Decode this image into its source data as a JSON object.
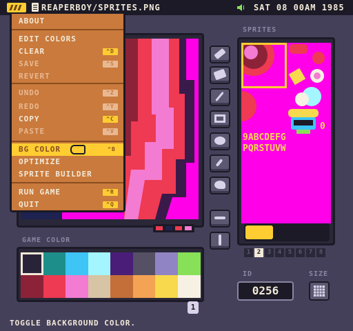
{
  "topbar": {
    "file_path": "REAPERBOY/SPRITES.PNG",
    "clock": "SAT 08 00AM 1985",
    "logo_icon": "app-logo-icon",
    "speaker_icon": "speaker-icon"
  },
  "menu": {
    "items": [
      {
        "label": "ABOUT",
        "shortcut": "",
        "enabled": true
      },
      {
        "label": "EDIT COLORS",
        "shortcut": "",
        "enabled": true
      },
      {
        "label": "CLEAR",
        "shortcut": "^D",
        "enabled": true
      },
      {
        "label": "SAVE",
        "shortcut": "^S",
        "enabled": false
      },
      {
        "label": "REVERT",
        "shortcut": "",
        "enabled": false
      },
      {
        "label": "UNDO",
        "shortcut": "^Z",
        "enabled": false
      },
      {
        "label": "REDO",
        "shortcut": "^Y",
        "enabled": false
      },
      {
        "label": "COPY",
        "shortcut": "^C",
        "enabled": true
      },
      {
        "label": "PASTE",
        "shortcut": "^V",
        "enabled": false
      },
      {
        "label": "BG COLOR",
        "shortcut": "^B",
        "enabled": true,
        "highlighted": true
      },
      {
        "label": "OPTIMIZE",
        "shortcut": "",
        "enabled": true
      },
      {
        "label": "SPRITE BUILDER",
        "shortcut": "",
        "enabled": true
      },
      {
        "label": "RUN GAME",
        "shortcut": "^R",
        "enabled": true
      },
      {
        "label": "QUIT",
        "shortcut": "^Q",
        "enabled": true
      }
    ]
  },
  "tools": [
    "pen-tool-icon",
    "eraser-tool-icon",
    "line-tool-icon",
    "rect-tool-icon",
    "ellipse-tool-icon",
    "eyedropper-tool-icon",
    "fill-tool-icon"
  ],
  "tools_transform": [
    "flip-horizontal-icon",
    "flip-vertical-icon"
  ],
  "sprites": {
    "label": "SPRITES",
    "font_row_1": "9ABCDEFG",
    "font_row_2": "PQRSTUVW",
    "font_extra": "0",
    "banks": [
      "1",
      "2",
      "3",
      "4",
      "5",
      "6",
      "7",
      "8"
    ],
    "active_bank": "2"
  },
  "id": {
    "label": "ID",
    "value": "0256"
  },
  "size": {
    "label": "SIZE"
  },
  "palette": {
    "label": "GAME COLOR",
    "page": "1",
    "colors": [
      "#29233a",
      "#1e8e8a",
      "#3ec4f5",
      "#a3f6ff",
      "#4a1e78",
      "#555064",
      "#9184c4",
      "#88e058",
      "#8c2238",
      "#ee3a52",
      "#f37cd2",
      "#d6c4a4",
      "#c46e3a",
      "#f4a254",
      "#f8d84c",
      "#f6f1e2"
    ],
    "selected_index": 0
  },
  "status": "TOGGLE BACKGROUND COLOR."
}
